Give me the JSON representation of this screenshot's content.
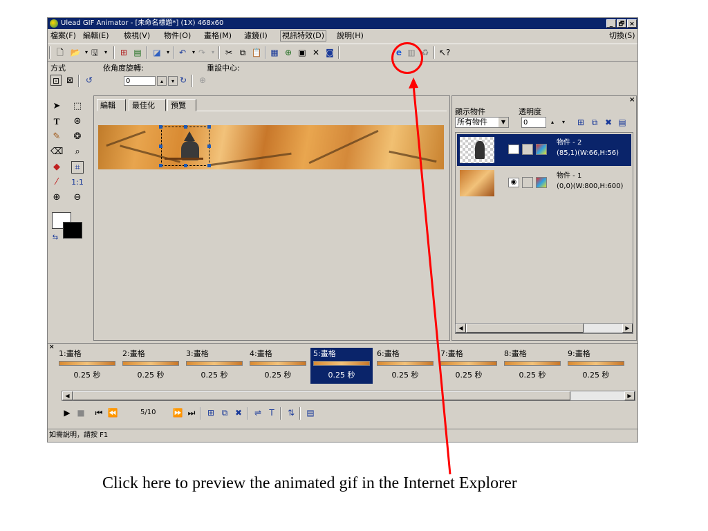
{
  "window": {
    "title": "Ulead GIF Animator - [未命名標題*] (1X) 468x60",
    "controls": [
      "_",
      "🗗",
      "×"
    ]
  },
  "menu": {
    "items": [
      "檔案(F)",
      "編輯(E)",
      "檢視(V)",
      "物件(O)",
      "畫格(M)",
      "濾鏡(I)",
      "視訊特效(D)",
      "說明(H)"
    ],
    "switch": "切換(S)"
  },
  "props": {
    "mode_label": "方式",
    "rotate_label": "依角度旋轉:",
    "rotate_value": "0",
    "reset_center_label": "重設中心:"
  },
  "tools": {
    "one_to_one": "1:1"
  },
  "editor": {
    "tabs": [
      "編輯",
      "最佳化",
      "預覽"
    ]
  },
  "objects": {
    "show_label": "顯示物件",
    "opacity_label": "透明度",
    "filter_value": "所有物件",
    "opacity_value": "0",
    "items": [
      {
        "name": "物件 - 2",
        "info": "(85,1)(W:66,H:56)",
        "selected": true
      },
      {
        "name": "物件 - 1",
        "info": "(0,0)(W:800,H:600)",
        "selected": false
      }
    ]
  },
  "frames": {
    "items": [
      {
        "label": "1:畫格",
        "delay": "0.25 秒"
      },
      {
        "label": "2:畫格",
        "delay": "0.25 秒"
      },
      {
        "label": "3:畫格",
        "delay": "0.25 秒"
      },
      {
        "label": "4:畫格",
        "delay": "0.25 秒"
      },
      {
        "label": "5:畫格",
        "delay": "0.25 秒"
      },
      {
        "label": "6:畫格",
        "delay": "0.25 秒"
      },
      {
        "label": "7:畫格",
        "delay": "0.25 秒"
      },
      {
        "label": "8:畫格",
        "delay": "0.25 秒"
      },
      {
        "label": "9:畫格",
        "delay": "0.25 秒"
      }
    ],
    "selected_index": 4,
    "counter": "5/10"
  },
  "status": {
    "text": "如需說明，請按 F1"
  },
  "annotation": {
    "caption": "Click here to preview the animated gif in the Internet Explorer",
    "color": "#ff0000"
  },
  "colors": {
    "titlebar": "#0a246a",
    "face": "#d4d0c8",
    "selection": "#0a246a"
  }
}
